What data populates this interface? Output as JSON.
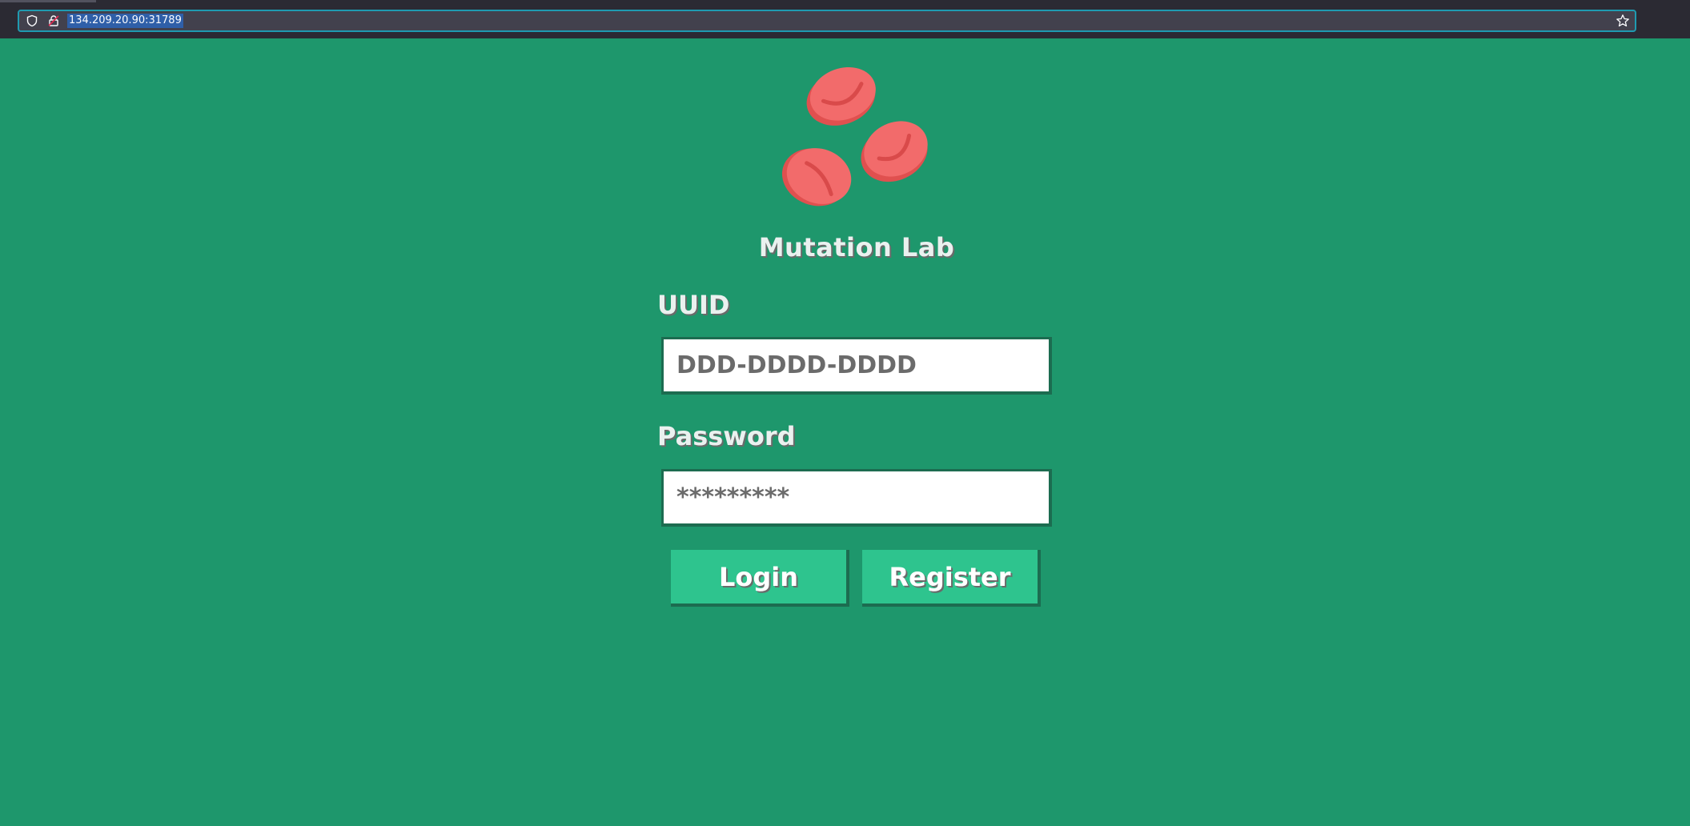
{
  "browser": {
    "url": "134.209.20.90:31789",
    "icons": [
      "shield-icon",
      "lock-icon",
      "star-icon"
    ]
  },
  "brand": {
    "title": "Mutation Lab",
    "logo_icon": "red-blood-cells-icon"
  },
  "form": {
    "uuid_label": "UUID",
    "uuid_placeholder": "DDD-DDDD-DDDD",
    "password_label": "Password",
    "password_placeholder": "*********",
    "login_label": "Login",
    "register_label": "Register"
  },
  "colors": {
    "background": "#1e976c",
    "button": "#2ec48e",
    "cell": "#f26b6b",
    "cell_shadow": "#e0504f"
  }
}
